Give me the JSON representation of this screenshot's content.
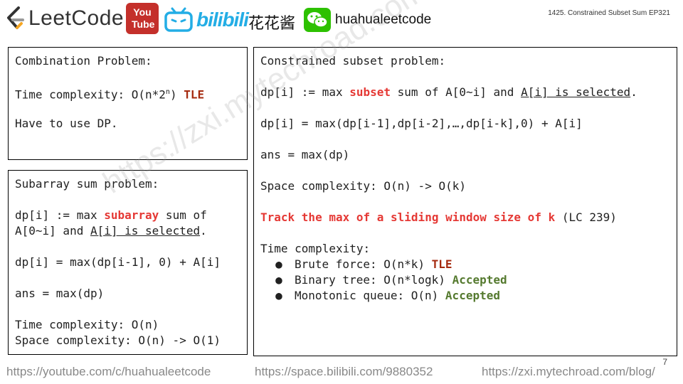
{
  "header": {
    "leetcode_brand": "LeetCode",
    "youtube_brand": "You Tube",
    "bilibili_brand": "bilibili",
    "author_zh": "花花酱",
    "handle": "huahualeetcode",
    "episode": "1425. Constrained Subset Sum EP321"
  },
  "combination": {
    "title": "Combination Problem:",
    "tc_prefix": "Time complexity: O(n*2",
    "tc_exp": "n",
    "tc_suffix": ") ",
    "tc_verdict": "TLE",
    "note": "Have to use DP."
  },
  "subarray": {
    "title": "Subarray sum problem:",
    "def_prefix": "dp[i] := max ",
    "def_highlight": "subarray",
    "def_suffix": " sum of",
    "def_line2_prefix": "A[0~i] and ",
    "def_line2_ul": "A[i] is selected",
    "def_line2_suffix": ".",
    "recurrence": "dp[i] = max(dp[i-1], 0) + A[i]",
    "ans": "ans = max(dp)",
    "time": "Time complexity: O(n)",
    "space": "Space complexity: O(n) -> O(1)"
  },
  "constrained": {
    "title": "Constrained subset problem:",
    "def_prefix": "dp[i] := max ",
    "def_highlight": "subset",
    "def_mid": " sum of A[0~i] and ",
    "def_ul": "A[i] is selected",
    "def_suffix": ".",
    "recurrence": "dp[i] = max(dp[i-1],dp[i-2],…,dp[i-k],0) + A[i]",
    "ans": "ans = max(dp)",
    "space": "Space complexity: O(n) -> O(k)",
    "track_highlight": "Track the max of a sliding window size of k",
    "track_suffix": " (LC 239)",
    "time_title": "Time complexity:",
    "approaches": [
      {
        "text": "Brute force: O(n*k) ",
        "verdict": "TLE",
        "verdict_color": "#a52a0f"
      },
      {
        "text": "Binary tree: O(n*logk) ",
        "verdict": "Accepted",
        "verdict_color": "#557a2f"
      },
      {
        "text": "Monotonic queue: O(n) ",
        "verdict": "Accepted",
        "verdict_color": "#557a2f"
      }
    ],
    "bullet": "●"
  },
  "watermark": "https://zxi.mytechroad.com/blog/  花花酱 LeetCode",
  "footer": {
    "youtube": "https://youtube.com/c/huahualeetcode",
    "bilibili": "https://space.bilibili.com/9880352",
    "blog": "https://zxi.mytechroad.com/blog/",
    "page_number": "7"
  },
  "colors": {
    "highlight_red": "#e53935",
    "tle_red": "#a52a0f",
    "accepted_green": "#557a2f",
    "youtube_red": "#c4302b",
    "bilibili_blue": "#23ade5",
    "wechat_green": "#2dc100"
  }
}
